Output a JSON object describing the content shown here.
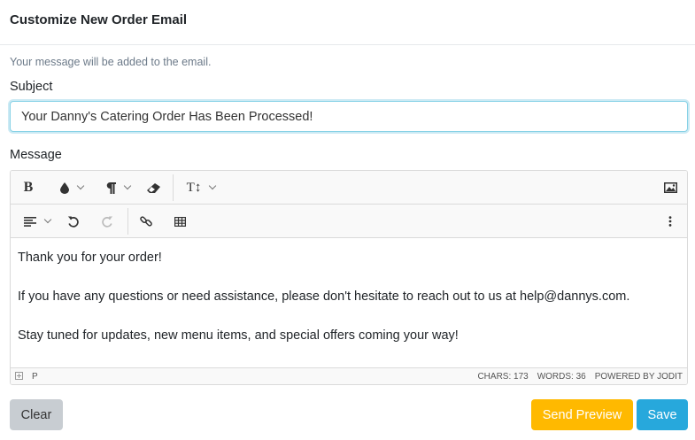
{
  "modal": {
    "title": "Customize New Order Email",
    "hint": "Your message will be added to the email."
  },
  "subject": {
    "label": "Subject",
    "value": "Your Danny's Catering Order Has Been Processed!"
  },
  "message": {
    "label": "Message",
    "paragraphs": [
      "Thank you for your order!",
      "If you have any questions or need assistance, please don't hesitate to reach out to us at help@dannys.com.",
      "Stay tuned for updates, new menu items, and special offers coming your way!"
    ]
  },
  "toolbar": {
    "bold_glyph": "B",
    "font_size_glyph": "T↕"
  },
  "statusbar": {
    "path": "P",
    "chars": "CHARS: 173",
    "words": "WORDS: 36",
    "powered": "POWERED BY JODIT"
  },
  "buttons": {
    "clear": "Clear",
    "send_preview": "Send Preview",
    "save": "Save"
  },
  "colors": {
    "preview_button": "#ffb900",
    "save_button": "#27a8dc",
    "clear_button": "#c8cdd2",
    "input_focus_border": "#86d1e6"
  }
}
